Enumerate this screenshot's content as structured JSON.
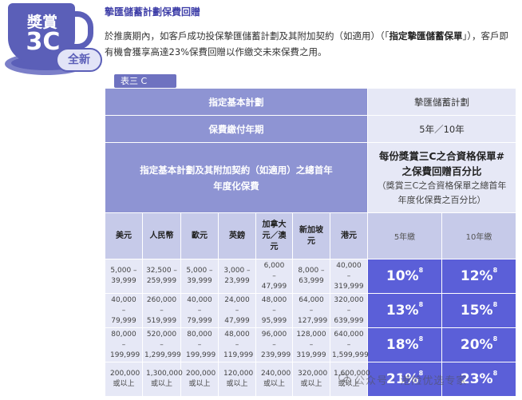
{
  "badge": {
    "line1": "獎賞",
    "line2": "3C",
    "pill": "全新"
  },
  "title": "摯匯儲蓄計劃保費回贈",
  "paragraph": {
    "part1": "於推廣期內，如客戶成功投保摯匯儲蓄計劃及其附加契約（如適用）（「",
    "bold": "指定摯匯儲蓄保單",
    "part2": "」），客戶即有機會獲享高達23%保費回贈以作繳交未來保費之用。"
  },
  "table_tag": "表三 C",
  "table": {
    "row_plan": {
      "label": "指定基本計劃",
      "value": "摯匯儲蓄計劃"
    },
    "row_term": {
      "label": "保費繳付年期",
      "value": "5年／10年"
    },
    "row_premium": {
      "label": "指定基本計劃及其附加契約（如適用）之總首年年度化保費",
      "right_title": "每份獎賞三C之合資格保單#之保費回贈百分比",
      "right_note": "（獎賞三C之合資格保單之總首年年度化保費之百分比）"
    },
    "currencies": [
      "美元",
      "人民幣",
      "歐元",
      "英鎊",
      "加拿大元／澳元",
      "新加坡元",
      "港元"
    ],
    "periods": [
      "5年繳",
      "10年繳"
    ],
    "rows": [
      {
        "bands": [
          "5,000 – 39,999",
          "32,500 – 259,999",
          "5,000 – 39,999",
          "3,000 – 23,999",
          "6,000 – 47,999",
          "8,000 – 63,999",
          "40,000 – 319,999"
        ],
        "p5": "10%",
        "p10": "12%"
      },
      {
        "bands": [
          "40,000 – 79,999",
          "260,000 – 519,999",
          "40,000 – 79,999",
          "24,000 – 47,999",
          "48,000 – 95,999",
          "64,000 – 127,999",
          "320,000 – 639,999"
        ],
        "p5": "13%",
        "p10": "15%"
      },
      {
        "bands": [
          "80,000 – 199,999",
          "520,000 – 1,299,999",
          "80,000 – 199,999",
          "48,000 – 119,999",
          "96,000 – 239,999",
          "128,000 – 319,999",
          "640,000 – 1,599,999"
        ],
        "p5": "18%",
        "p10": "20%"
      },
      {
        "bands": [
          "200,000 或以上",
          "1,300,000 或以上",
          "200,000 或以上",
          "120,000 或以上",
          "240,000 或以上",
          "320,000 或以上",
          "1,600,000 或以上"
        ],
        "p5": "21%",
        "p10": "23%"
      }
    ],
    "footnote_mark": "8"
  },
  "watermark": "公众号 · 港险优选专家",
  "colors": {
    "primary": "#5b5fd8",
    "header": "#8e94d3",
    "light": "#e6e8f6",
    "accent": "#3f3fa8"
  }
}
